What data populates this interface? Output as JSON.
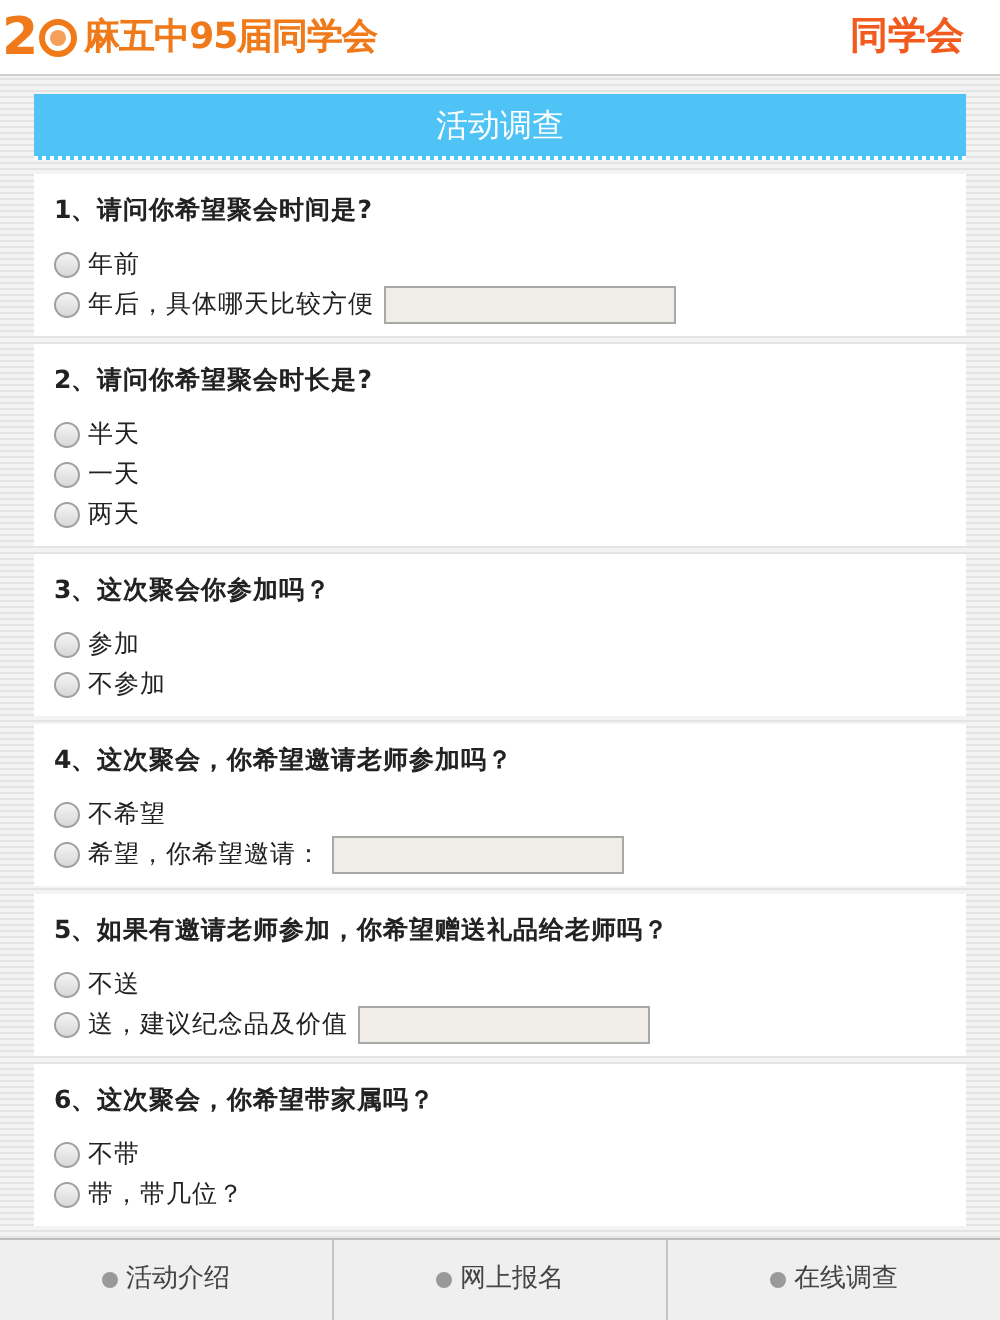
{
  "header": {
    "logo_digit": "2",
    "title": "麻五中95届同学会",
    "right_title": "同学会"
  },
  "survey": {
    "title": "活动调查",
    "questions": [
      {
        "title": "1、请问你希望聚会时间是?",
        "options": [
          {
            "kind": "plain",
            "label": "年前",
            "selected": false
          },
          {
            "kind": "with_input",
            "label": "年后，具体哪天比较方便",
            "selected": false
          }
        ]
      },
      {
        "title": "2、请问你希望聚会时长是?",
        "options": [
          {
            "kind": "plain",
            "label": "半天",
            "selected": false
          },
          {
            "kind": "plain",
            "label": "一天",
            "selected": false
          },
          {
            "kind": "plain",
            "label": "两天",
            "selected": false
          }
        ]
      },
      {
        "title": "3、这次聚会你参加吗？",
        "options": [
          {
            "kind": "plain",
            "label": "参加",
            "selected": false
          },
          {
            "kind": "plain",
            "label": "不参加",
            "selected": false
          }
        ]
      },
      {
        "title": "4、这次聚会，你希望邀请老师参加吗？",
        "options": [
          {
            "kind": "plain",
            "label": "不希望",
            "selected": false
          },
          {
            "kind": "with_input",
            "label": "希望，你希望邀请：",
            "selected": false
          }
        ]
      },
      {
        "title": "5、如果有邀请老师参加，你希望赠送礼品给老师吗？",
        "options": [
          {
            "kind": "plain",
            "label": "不送",
            "selected": false
          },
          {
            "kind": "with_input",
            "label": "送，建议纪念品及价值",
            "selected": false
          }
        ]
      },
      {
        "title": "6、这次聚会，你希望带家属吗？",
        "options": [
          {
            "kind": "plain",
            "label": "不带",
            "selected": false
          },
          {
            "kind": "plain",
            "label": "带，带几位？",
            "selected": false
          }
        ]
      }
    ]
  },
  "bottom_nav": [
    {
      "label": "活动介绍"
    },
    {
      "label": "网上报名"
    },
    {
      "label": "在线调查"
    }
  ]
}
